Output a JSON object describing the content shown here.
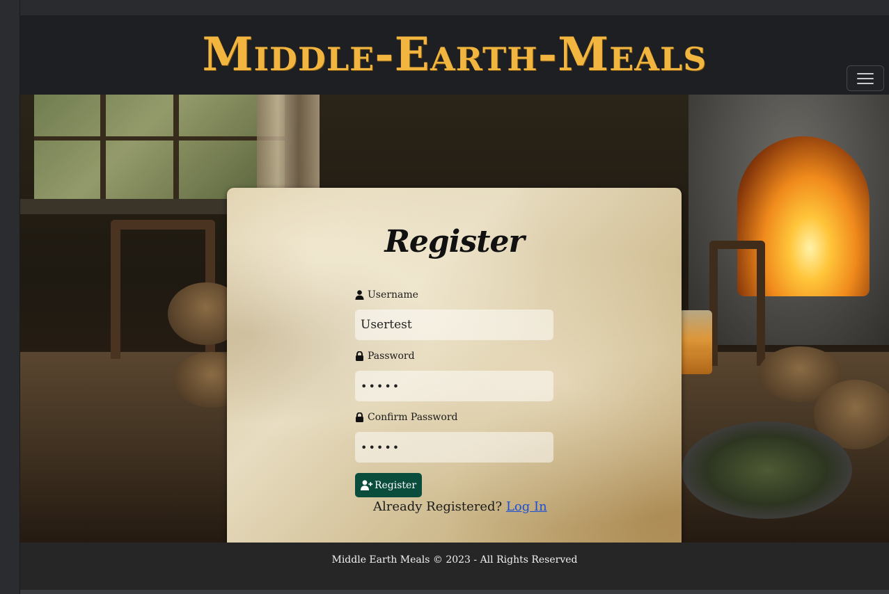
{
  "navbar": {
    "brand": "Middle-Earth-Meals",
    "toggle_icon": "hamburger-menu-icon"
  },
  "register": {
    "title": "Register",
    "username_label": "Username",
    "username_value": "Usertest",
    "password_label": "Password",
    "password_value": "•••••",
    "confirm_label": "Confirm Password",
    "confirm_value": "•••••",
    "submit_label": "Register",
    "already_text": "Already Registered?",
    "login_link": "Log In"
  },
  "footer": {
    "text": "Middle Earth Meals © 2023 - All Rights Reserved"
  },
  "colors": {
    "brand": "#f2b53f",
    "button": "#0b4d3d",
    "link": "#1a4fd6"
  }
}
